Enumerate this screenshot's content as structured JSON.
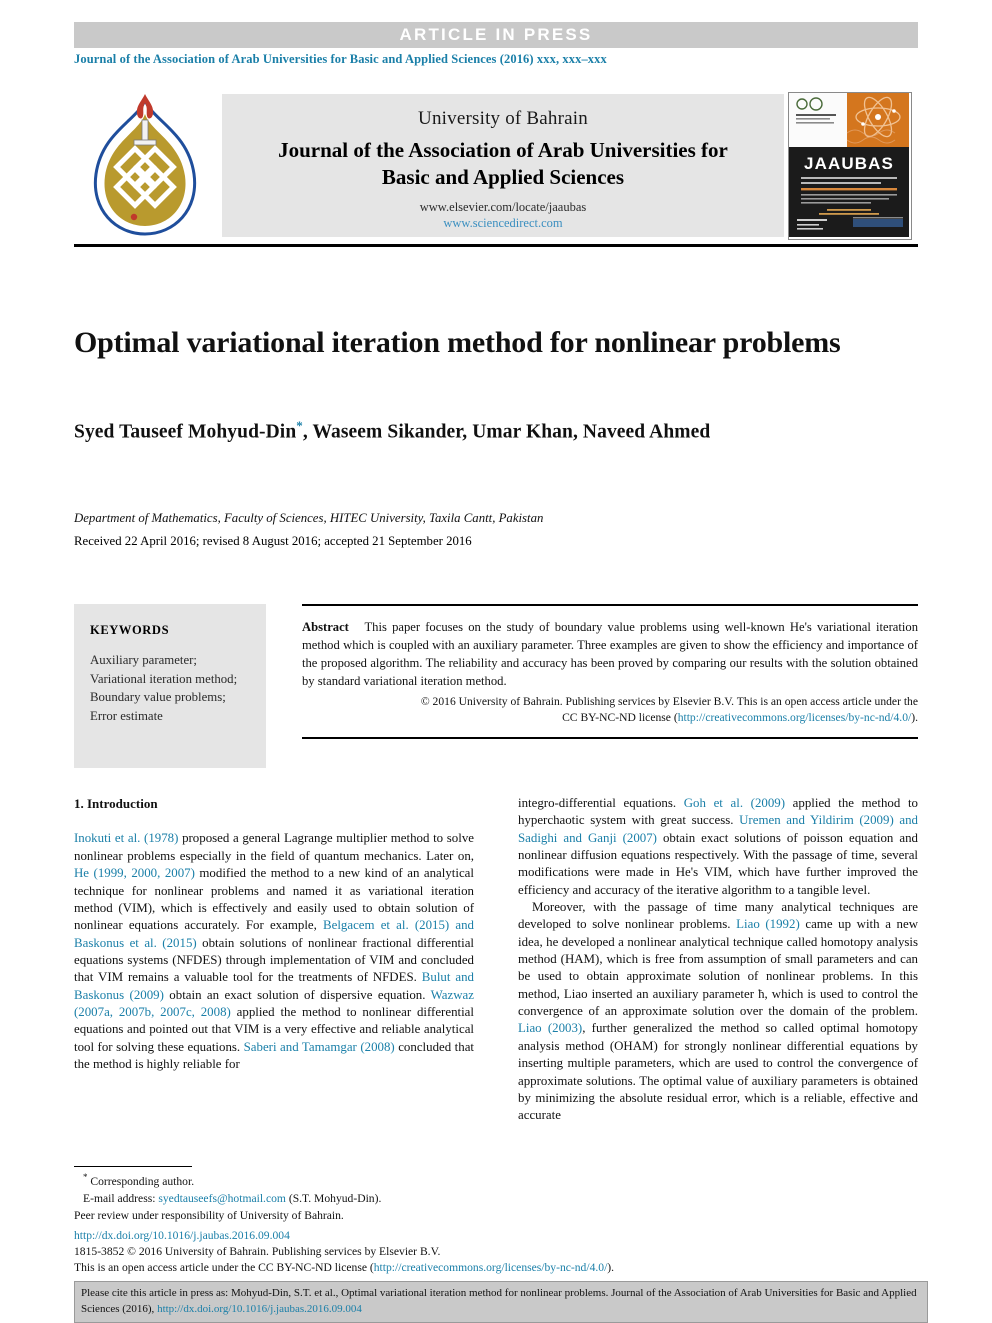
{
  "banner": {
    "article_in_press": "ARTICLE  IN  PRESS",
    "journal_citation_line": "Journal of the Association of Arab Universities for Basic and Applied Sciences (2016) xxx, xxx–xxx"
  },
  "masthead": {
    "university": "University of Bahrain",
    "journal_title_line1": "Journal of the Association of Arab Universities for",
    "journal_title_line2": "Basic and Applied Sciences",
    "elsevier_url": "www.elsevier.com/locate/jaaubas",
    "sciencedirect_url": "www.sciencedirect.com",
    "logo_alt": "university-of-bahrain-logo",
    "cover_alt": "jaaubas-journal-cover",
    "cover_wordmark": "JAAUBAS"
  },
  "article": {
    "title": "Optimal variational iteration method for nonlinear problems",
    "authors": "Syed Tauseef Mohyud-Din",
    "corresponding_marker": "*",
    "authors_rest": ", Waseem Sikander, Umar Khan, Naveed Ahmed",
    "affiliation": "Department of Mathematics, Faculty of Sciences, HITEC University, Taxila Cantt, Pakistan",
    "history": "Received 22 April 2016; revised 8 August 2016; accepted 21 September 2016"
  },
  "keywords": {
    "heading": "KEYWORDS",
    "items": [
      "Auxiliary parameter;",
      "Variational iteration method;",
      "Boundary value problems;",
      "Error estimate"
    ]
  },
  "abstract": {
    "label": "Abstract",
    "text": "This paper focuses on the study of boundary value problems using well-known He's variational iteration method which is coupled with an auxiliary parameter. Three examples are given to show the efficiency and importance of the proposed algorithm. The reliability and accuracy has been proved by comparing our results with the solution obtained by standard variational iteration method.",
    "copyright_line1": "© 2016 University of Bahrain. Publishing services by Elsevier B.V. This is an open access article under the",
    "copyright_line2_pre": "CC BY-NC-ND license (",
    "copyright_license_url": "http://creativecommons.org/licenses/by-nc-nd/4.0/",
    "copyright_line2_post": ")."
  },
  "body": {
    "section_heading": "1. Introduction",
    "left_column": [
      {
        "segments": [
          {
            "t": "Inokuti et al. (1978)",
            "link": true
          },
          {
            "t": " proposed a general Lagrange multiplier method to solve nonlinear problems especially in the field of quantum mechanics. Later on, ",
            "link": false
          },
          {
            "t": "He (1999, 2000, 2007)",
            "link": true
          },
          {
            "t": " modified the method to a new kind of an analytical technique for nonlinear problems and named it as variational iteration method (VIM), which is effectively and easily used to obtain solution of nonlinear equations accurately. For example, ",
            "link": false
          },
          {
            "t": "Belgacem et al. (2015) and Baskonus et al. (2015)",
            "link": true
          },
          {
            "t": " obtain solutions of nonlinear fractional differential equations systems (NFDES) through implementation of VIM and concluded that VIM remains a valuable tool for the treatments of NFDES. ",
            "link": false
          },
          {
            "t": "Bulut and Baskonus (2009)",
            "link": true
          },
          {
            "t": " obtain an exact solution of dispersive equation. ",
            "link": false
          },
          {
            "t": "Wazwaz (2007a, 2007b, 2007c, 2008)",
            "link": true
          },
          {
            "t": " applied the method to nonlinear differential equations and pointed out that VIM is a very effective and reliable analytical tool for solving these equations. ",
            "link": false
          },
          {
            "t": "Saberi and Tamamgar (2008)",
            "link": true
          },
          {
            "t": " concluded that the method is highly reliable for",
            "link": false
          }
        ]
      }
    ],
    "right_column": [
      {
        "segments": [
          {
            "t": "integro-differential equations. ",
            "link": false
          },
          {
            "t": "Goh et al. (2009)",
            "link": true
          },
          {
            "t": " applied the method to hyperchaotic system with great success. ",
            "link": false
          },
          {
            "t": "Uremen and Yildirim (2009) and Sadighi and Ganji (2007)",
            "link": true
          },
          {
            "t": " obtain exact solutions of poisson equation and nonlinear diffusion equations respectively. With the passage of time, several modifications were made in He's VIM, which have further improved the efficiency and accuracy of the iterative algorithm to a tangible level.",
            "link": false
          }
        ]
      },
      {
        "segments": [
          {
            "t": "Moreover, with the passage of time many analytical techniques are developed to solve nonlinear problems. ",
            "link": false
          },
          {
            "t": "Liao (1992)",
            "link": true
          },
          {
            "t": " came up with a new idea, he developed a nonlinear analytical technique called homotopy analysis method (HAM), which is free from assumption of small parameters and can be used to obtain approximate solution of nonlinear problems. In this method, Liao inserted an auxiliary parameter ħ, which is used to control the convergence of an approximate solution over the domain of the problem. ",
            "link": false
          },
          {
            "t": "Liao (2003)",
            "link": true
          },
          {
            "t": ", further generalized the method so called optimal homotopy analysis method (OHAM) for strongly nonlinear differential equations by inserting multiple parameters, which are used to control the convergence of approximate solutions. The optimal value of auxiliary parameters is obtained by minimizing the absolute residual error, which is a reliable, effective and accurate",
            "link": false
          }
        ]
      }
    ]
  },
  "footnotes": {
    "corresponding_marker": "*",
    "corresponding_author": "Corresponding author.",
    "email_label": "E-mail address:",
    "email": "syedtauseefs@hotmail.com",
    "email_owner": "(S.T. Mohyud-Din).",
    "peer_review": "Peer review under responsibility of University of Bahrain.",
    "doi_url": "http://dx.doi.org/10.1016/j.jaubas.2016.09.004",
    "issn_line": "1815-3852 © 2016 University of Bahrain. Publishing services by Elsevier B.V.",
    "oa_line_pre": "This is an open access article under the CC BY-NC-ND license (",
    "oa_license_url": "http://creativecommons.org/licenses/by-nc-nd/4.0/",
    "oa_line_post": ")."
  },
  "citation_box": {
    "text_pre": "Please cite this article in press as: Mohyud-Din, S.T. et al., Optimal variational iteration method for nonlinear problems. Journal of the Association of Arab Universities for Basic and Applied Sciences (2016), ",
    "doi": "http://dx.doi.org/10.1016/j.jaubas.2016.09.004"
  },
  "colors": {
    "link": "#1a7fa8",
    "band_gray": "#c9c9c9",
    "panel_gray": "#e5e5e5",
    "logo_gold": "#b99a2e",
    "logo_blue": "#1f4e9c",
    "cover_orange": "#d4761e"
  }
}
